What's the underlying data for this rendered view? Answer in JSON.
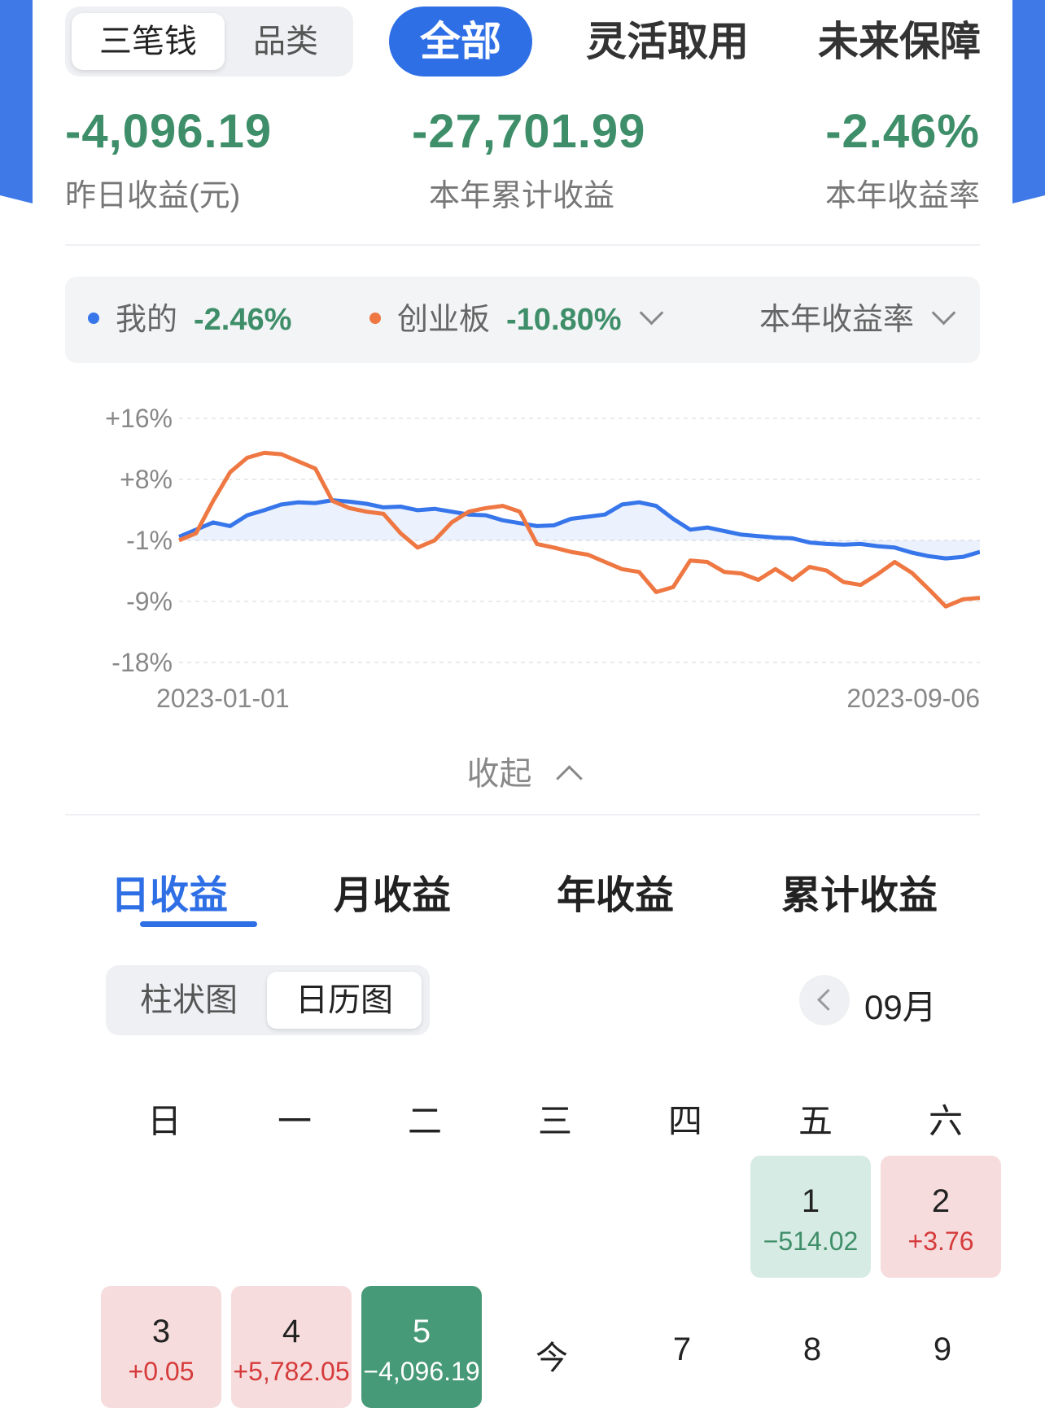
{
  "top_switch": {
    "options": [
      "三笔钱",
      "品类"
    ],
    "selected": "三笔钱"
  },
  "top_tabs": [
    "全部",
    "灵活取用",
    "未来保障"
  ],
  "stats": [
    {
      "value": "-4,096.19",
      "label": "昨日收益(元)"
    },
    {
      "value": "-27,701.99",
      "label": "本年累计收益"
    },
    {
      "value": "-2.46%",
      "label": "本年收益率"
    }
  ],
  "legend": {
    "mine_label": "我的",
    "mine_value": "-2.46%",
    "bench_label": "创业板",
    "bench_value": "-10.80%",
    "metric": "本年收益率"
  },
  "colors": {
    "mine": "#3776ea",
    "bench": "#ee7742",
    "accent": "#2f6fe6",
    "down": "#3e8e69",
    "up": "#d63b3b"
  },
  "chart_data": {
    "type": "line",
    "x_start": "2023-01-01",
    "x_end": "2023-09-06",
    "y_ticks": [
      "+16%",
      "+8%",
      "-1%",
      "-9%",
      "-18%"
    ],
    "ylim": [
      -18,
      16
    ],
    "series": [
      {
        "name": "我的",
        "values": [
          -0.5,
          0.5,
          1.5,
          1.0,
          2.5,
          3.2,
          4.0,
          4.3,
          4.2,
          4.6,
          4.4,
          4.1,
          3.6,
          3.7,
          3.2,
          3.4,
          3.0,
          2.6,
          2.5,
          1.8,
          1.4,
          1.0,
          1.1,
          2.0,
          2.3,
          2.6,
          4.0,
          4.3,
          3.8,
          2.0,
          0.5,
          0.8,
          0.3,
          -0.2,
          -0.4,
          -0.6,
          -0.7,
          -1.3,
          -1.5,
          -1.6,
          -1.5,
          -1.8,
          -2.0,
          -2.7,
          -3.2,
          -3.5,
          -3.3,
          -2.6
        ]
      },
      {
        "name": "创业板",
        "values": [
          -1.0,
          0.0,
          4.5,
          8.5,
          10.5,
          11.2,
          11.0,
          10.0,
          9.0,
          4.5,
          3.5,
          3.0,
          2.7,
          0.0,
          -2.0,
          -1.0,
          1.5,
          3.0,
          3.5,
          3.8,
          3.0,
          -1.5,
          -2.0,
          -2.6,
          -3.0,
          -4.0,
          -5.0,
          -5.4,
          -8.2,
          -7.5,
          -3.8,
          -4.0,
          -5.4,
          -5.6,
          -6.5,
          -5.0,
          -6.5,
          -4.7,
          -5.2,
          -6.8,
          -7.2,
          -5.7,
          -4.0,
          -5.5,
          -7.8,
          -10.2,
          -9.2,
          -9.0
        ]
      }
    ]
  },
  "collapse_label": "收起",
  "period_tabs": [
    "日收益",
    "月收益",
    "年收益",
    "累计收益"
  ],
  "view_switch": {
    "options": [
      "柱状图",
      "日历图"
    ],
    "selected": "日历图"
  },
  "month_label": "09月",
  "calendar": {
    "weekdays": [
      "日",
      "一",
      "二",
      "三",
      "四",
      "五",
      "六"
    ],
    "days": [
      {
        "day": "1",
        "profit": "−514.02"
      },
      {
        "day": "2",
        "profit": "+3.76"
      },
      {
        "day": "3",
        "profit": "+0.05"
      },
      {
        "day": "4",
        "profit": "+5,782.05"
      },
      {
        "day": "5",
        "profit": "−4,096.19"
      },
      {
        "day": "今",
        "profit": ""
      },
      {
        "day": "7",
        "profit": ""
      },
      {
        "day": "8",
        "profit": ""
      },
      {
        "day": "9",
        "profit": ""
      }
    ]
  }
}
